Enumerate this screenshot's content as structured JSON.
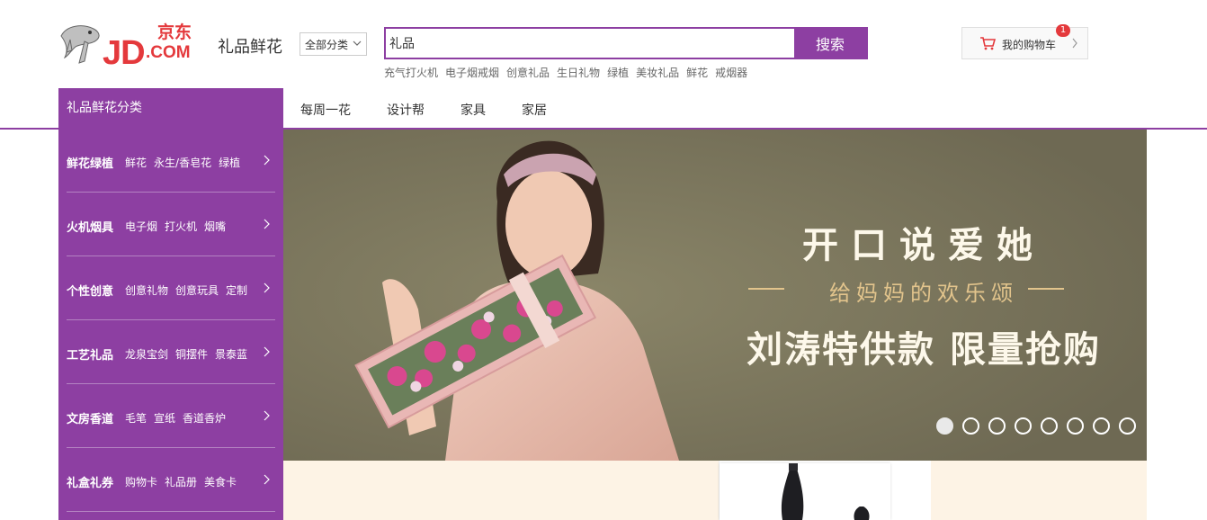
{
  "header": {
    "logo_text": "JD.COM",
    "logo_cn": "京东",
    "channel_title": "礼品鲜花",
    "category_select": "全部分类",
    "search_value": "礼品",
    "search_button": "搜索",
    "hot_words": [
      "充气打火机",
      "电子烟戒烟",
      "创意礼品",
      "生日礼物",
      "绿植",
      "美妆礼品",
      "鲜花",
      "戒烟器"
    ],
    "cart_label": "我的购物车",
    "cart_count": "1"
  },
  "nav": {
    "category_title": "礼品鲜花分类",
    "links": [
      "每周一花",
      "设计帮",
      "家具",
      "家居"
    ]
  },
  "sidebar": {
    "items": [
      {
        "name": "鲜花绿植",
        "subs": [
          "鲜花",
          "永生/香皂花",
          "绿植"
        ]
      },
      {
        "name": "火机烟具",
        "subs": [
          "电子烟",
          "打火机",
          "烟嘴"
        ]
      },
      {
        "name": "个性创意",
        "subs": [
          "创意礼物",
          "创意玩具",
          "定制"
        ]
      },
      {
        "name": "工艺礼品",
        "subs": [
          "龙泉宝剑",
          "铜摆件",
          "景泰蓝"
        ]
      },
      {
        "name": "文房香道",
        "subs": [
          "毛笔",
          "宣纸",
          "香道香炉"
        ]
      },
      {
        "name": "礼盒礼券",
        "subs": [
          "购物卡",
          "礼品册",
          "美食卡"
        ]
      }
    ]
  },
  "banner": {
    "headline": "开口说爱她",
    "subline": "给妈妈的欢乐颂",
    "tagline": "刘涛特供款 限量抢购",
    "slide_count": 8,
    "active_slide": 1
  },
  "colors": {
    "brand_purple": "#8d3fa2",
    "jd_red": "#e4393c",
    "banner_bg": "#7b765f",
    "strip_bg": "#fdf3e5"
  }
}
